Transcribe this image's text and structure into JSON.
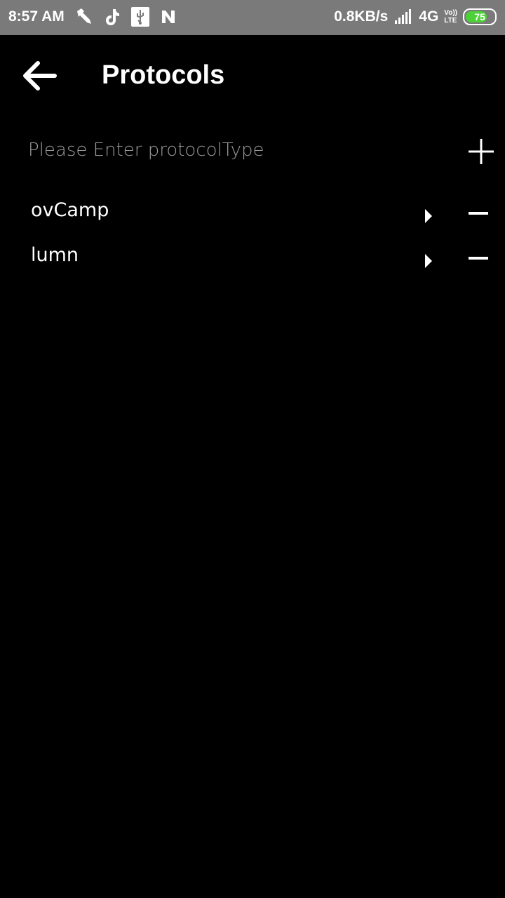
{
  "status_bar": {
    "time": "8:57 AM",
    "left_icons": [
      "screwdriver-icon",
      "tiktok-icon",
      "usb-icon",
      "n-icon"
    ],
    "network_speed": "0.8KB/s",
    "signal_icon": "signal-icon",
    "network_type": "4G",
    "volte_label_top": "Vo))",
    "volte_label_bottom": "LTE",
    "battery_level": "75",
    "battery_fraction": 0.75,
    "battery_color": "#4cd137"
  },
  "app_bar": {
    "back_icon": "arrow-left-icon",
    "title": "Protocols"
  },
  "input": {
    "placeholder": "Please Enter protocolType",
    "value": "",
    "add_icon": "plus-icon"
  },
  "protocols": [
    {
      "label": "ovCamp",
      "expand_icon": "caret-right-icon",
      "remove_icon": "minus-icon"
    },
    {
      "label": "lumn",
      "expand_icon": "caret-right-icon",
      "remove_icon": "minus-icon"
    }
  ],
  "colors": {
    "background": "#000000",
    "status_bar": "#7a7a7a",
    "text": "#ffffff",
    "placeholder": "#9a9a9a"
  }
}
